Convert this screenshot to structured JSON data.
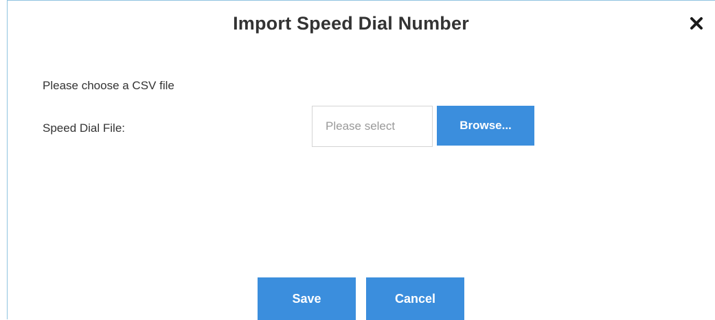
{
  "dialog": {
    "title": "Import Speed Dial Number",
    "close_icon": "close-icon"
  },
  "form": {
    "hint": "Please choose a CSV file",
    "file_label": "Speed Dial File:",
    "file_placeholder": "Please select",
    "browse_label": "Browse..."
  },
  "footer": {
    "save_label": "Save",
    "cancel_label": "Cancel"
  },
  "colors": {
    "accent": "#3b8edd",
    "border": "#8fc3e0",
    "text": "#333333",
    "placeholder": "#999999"
  }
}
